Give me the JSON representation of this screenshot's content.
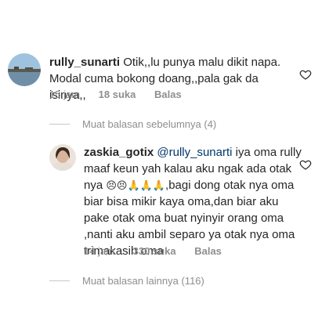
{
  "comment1": {
    "username": "rully_sunarti",
    "text": " Otik,,lu punya malu dikit napa. Modal cuma bokong doang,,pala gak da isinya,,",
    "time": "15 jam",
    "likes": "18 suka",
    "reply": "Balas",
    "like_icon": "heart-outline-icon"
  },
  "view_previous": "Muat balasan sebelumnya (4)",
  "comment2": {
    "username": "zaskia_gotix",
    "mention": "@rully_sunarti",
    "text_a": " iya oma rully maaf keun yah kalau aku ngak ada otak nya ",
    "emojis": "😣😣🙏🙏🙏",
    "text_b": ",bagi dong otak nya oma biar bisa mikir kaya oma,dan biar aku pake otak oma buat nyinyir orang oma ,nanti aku ambil separo ya otak nya oma trimakasih oma",
    "time": "14 jam",
    "likes": "330 suka",
    "reply": "Balas",
    "like_icon": "heart-outline-icon"
  },
  "view_more": "Muat balasan lainnya (116)"
}
